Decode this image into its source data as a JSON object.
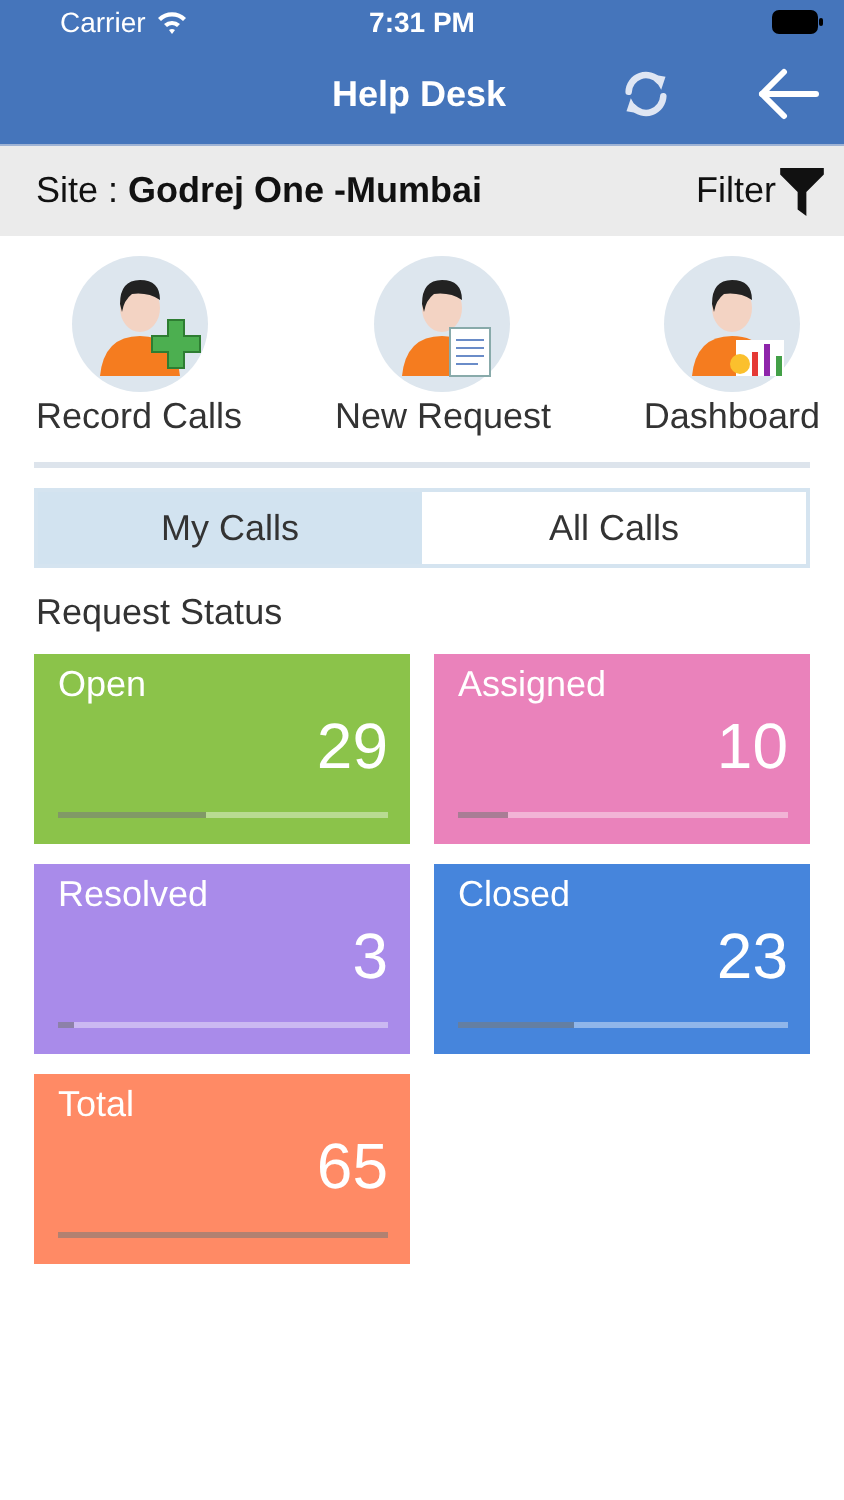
{
  "status_bar": {
    "carrier": "Carrier",
    "time": "7:31 PM"
  },
  "header": {
    "title": "Help Desk"
  },
  "site_bar": {
    "label": "Site : ",
    "site": "Godrej One -Mumbai",
    "filter": "Filter"
  },
  "actions": [
    {
      "label": "Record Calls",
      "kind": "plus"
    },
    {
      "label": "New Request",
      "kind": "document"
    },
    {
      "label": "Dashboard",
      "kind": "chart"
    }
  ],
  "tabs": [
    {
      "label": "My Calls",
      "selected": true
    },
    {
      "label": "All Calls",
      "selected": false
    }
  ],
  "section_title": "Request Status",
  "cards": [
    {
      "label": "Open",
      "count": "29",
      "level": 0.45,
      "color": "#8bc34a"
    },
    {
      "label": "Assigned",
      "count": "10",
      "level": 0.15,
      "color": "#ea82bb"
    },
    {
      "label": "Resolved",
      "count": "3",
      "level": 0.05,
      "color": "#a98bea"
    },
    {
      "label": "Closed",
      "count": "23",
      "level": 0.35,
      "color": "#4685dc"
    },
    {
      "label": "Total",
      "count": "65",
      "level": 1,
      "color": "#ff8a65"
    }
  ]
}
